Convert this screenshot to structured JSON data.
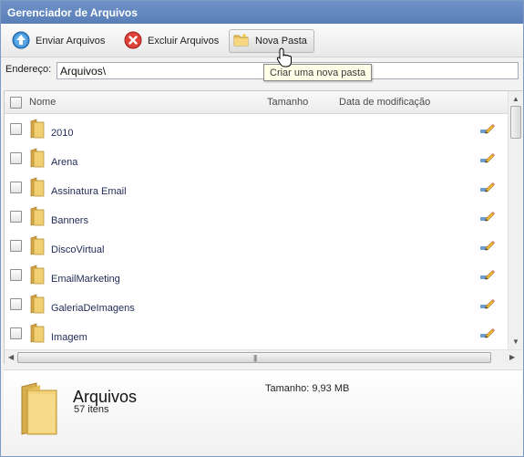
{
  "window": {
    "title": "Gerenciador de Arquivos"
  },
  "toolbar": {
    "upload_label": "Enviar Arquivos",
    "delete_label": "Excluir Arquivos",
    "new_folder_label": "Nova Pasta",
    "new_folder_tooltip": "Criar uma nova pasta"
  },
  "address": {
    "label": "Endereço:",
    "value": "Arquivos\\"
  },
  "columns": {
    "name": "Nome",
    "size": "Tamanho",
    "modified": "Data de modificação"
  },
  "folders": [
    {
      "name": "2010"
    },
    {
      "name": "Arena"
    },
    {
      "name": "Assinatura Email"
    },
    {
      "name": "Banners"
    },
    {
      "name": "DiscoVirtual"
    },
    {
      "name": "EmailMarketing"
    },
    {
      "name": "GaleriaDeImagens"
    },
    {
      "name": "Imagem"
    }
  ],
  "icons": {
    "upload": "arrow-up-circle-icon",
    "delete": "x-circle-icon",
    "new_folder": "folder-new-icon",
    "folder": "folder-icon",
    "edit": "pencil-icon"
  },
  "details": {
    "name": "Arquivos",
    "count": "57 itens",
    "size": "Tamanho: 9,93 MB"
  },
  "colors": {
    "titlebar": "#5a7fb8",
    "folder": "#e8c15e",
    "upload_accent": "#2f7fc9",
    "delete_accent": "#d9312b"
  }
}
